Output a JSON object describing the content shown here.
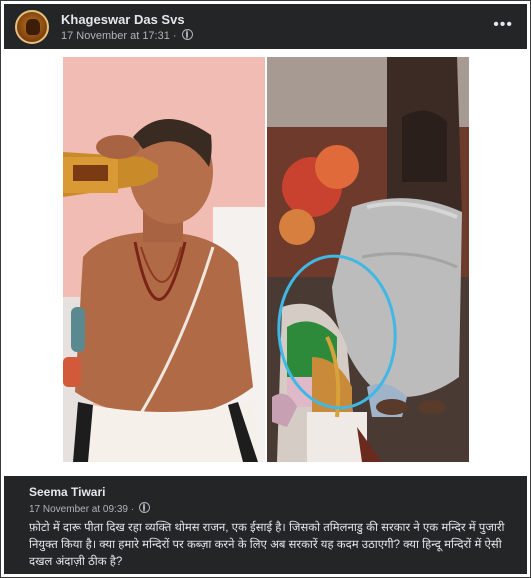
{
  "post": {
    "author": "Khageswar Das Svs",
    "timestamp": "17 November at 17:31 ·",
    "privacy_icon": "globe-icon",
    "more_icon": "more-horizontal-icon",
    "more_label": "•••"
  },
  "comment": {
    "author": "Seema Tiwari",
    "timestamp": "17 November at 09:39 ·",
    "privacy_icon": "globe-icon",
    "text": "फ़ोटो में दारू पीता दिख रहा व्यक्ति थोमस राजन, एक ईसाई है। जिसको तमिलनाडु की सरकार ने एक मन्दिर में पुजारी नियुक्त किया है। क्या हमारे मन्दिरों पर कब्ज़ा करने के लिए अब सरकारें यह कदम उठाएगी? क्या हिन्दू मन्दिरों में ऐसी दखल अंदाज़ी ठीक है?"
  },
  "colors": {
    "header_bg": "#242526",
    "text_primary": "#e4e6eb",
    "text_secondary": "#b0b3b8",
    "highlight_circle": "#3fb8e6"
  }
}
